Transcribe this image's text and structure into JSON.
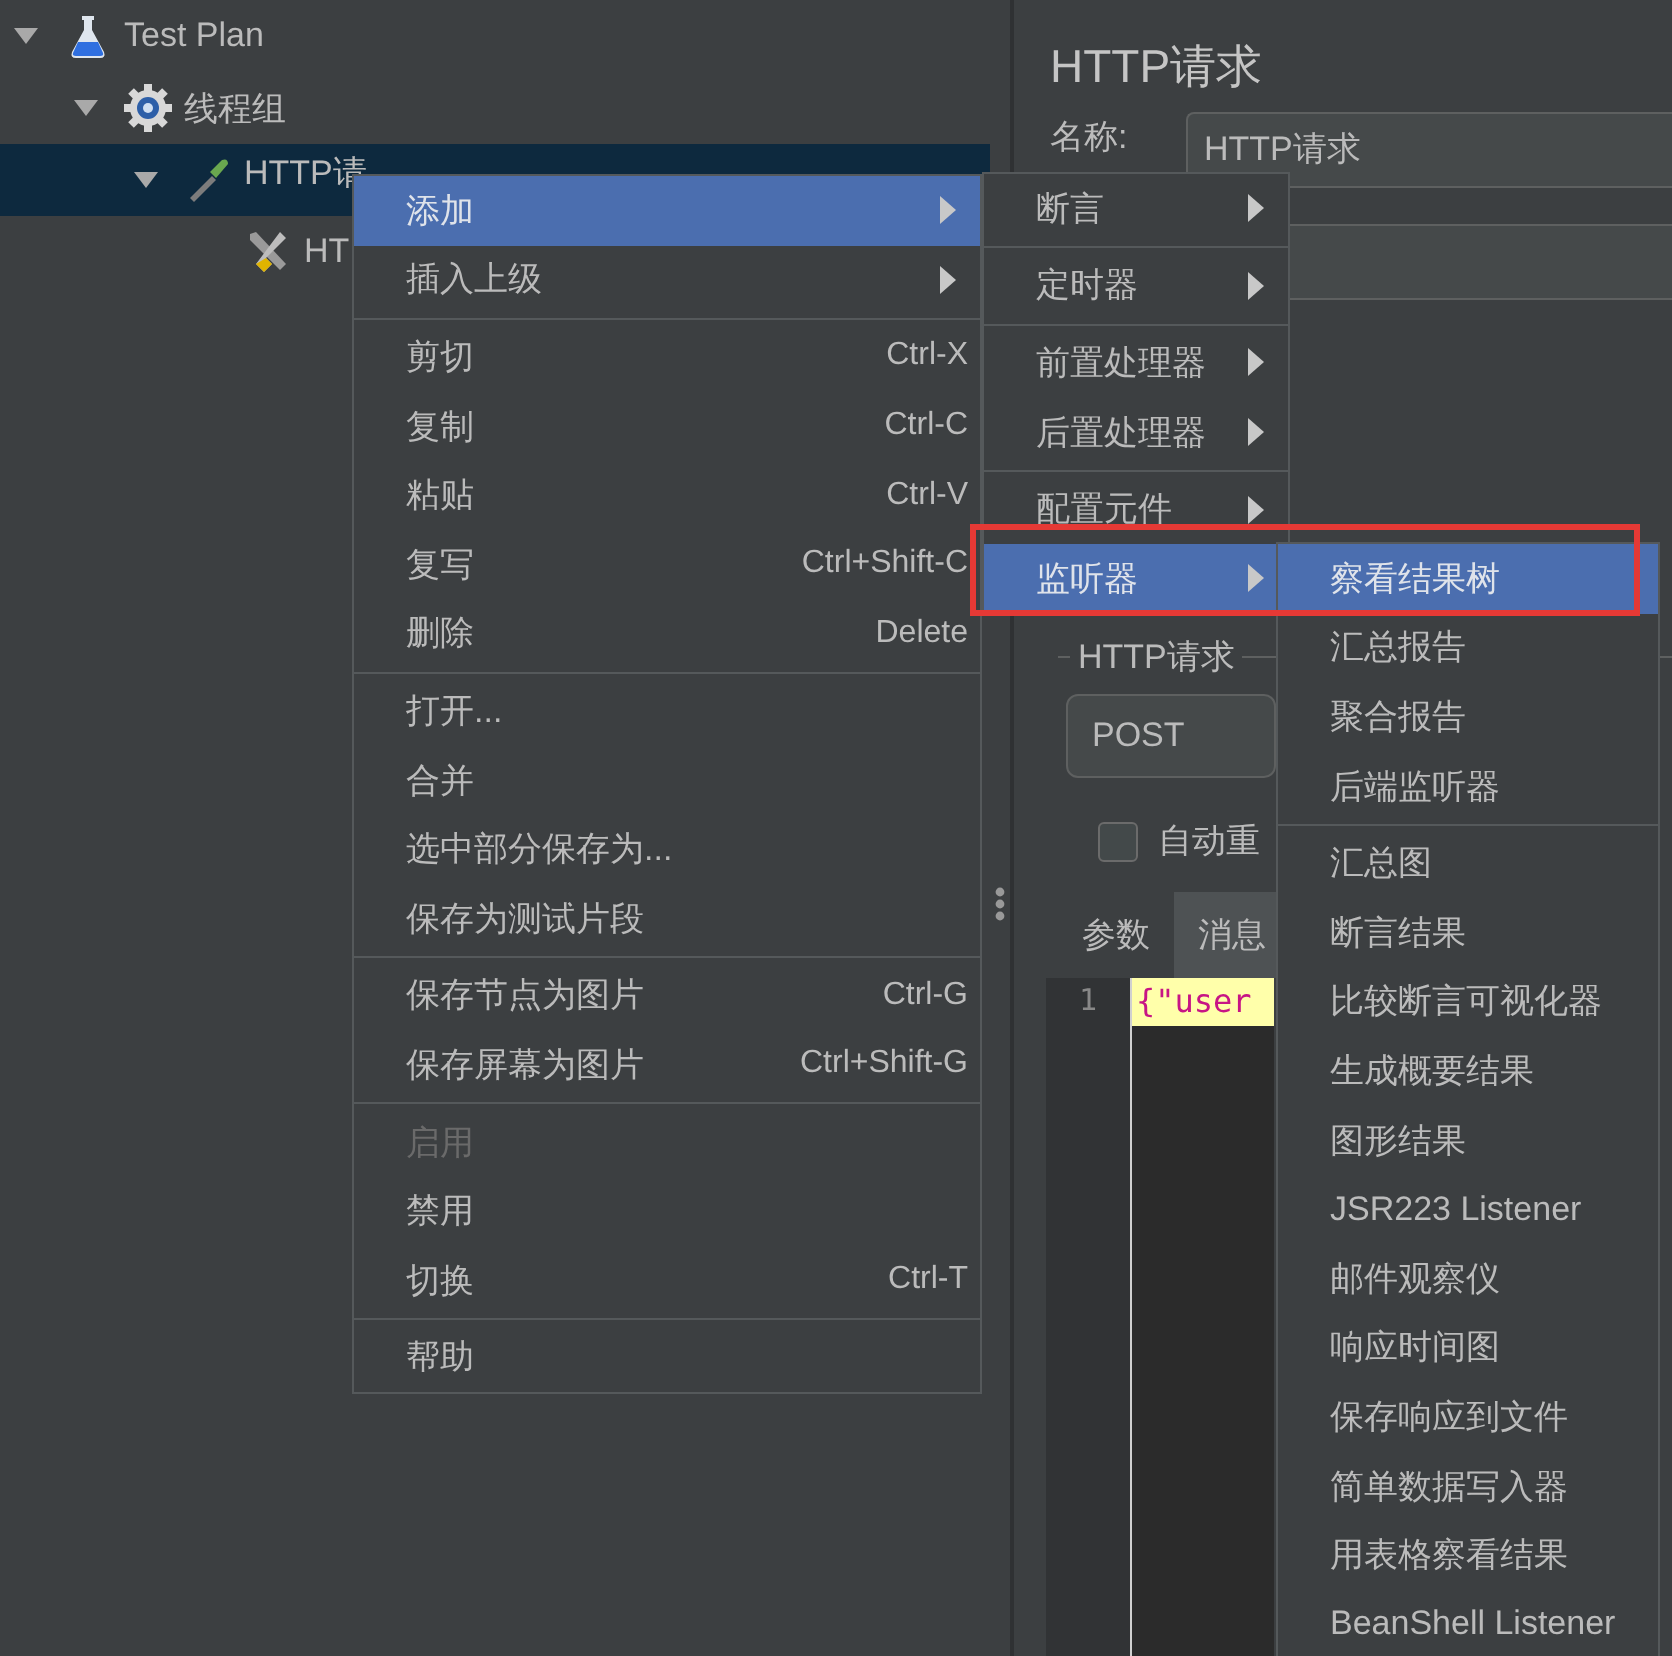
{
  "tree": [
    {
      "label": "Test Plan",
      "kind": "plan",
      "expanded": true,
      "selected": false,
      "children": [
        {
          "label": "线程组",
          "kind": "thread-group",
          "expanded": true,
          "selected": false,
          "children": [
            {
              "label": "HTTP请",
              "kind": "sampler",
              "expanded": true,
              "selected": true,
              "children": [
                {
                  "label": "HT",
                  "kind": "config",
                  "selected": false
                }
              ]
            }
          ]
        }
      ]
    }
  ],
  "editor": {
    "title": "HTTP请求",
    "name_label": "名称:",
    "name_value": "HTTP请求",
    "section_title": "HTTP请求",
    "method": "POST",
    "checkbox": {
      "label": "自动重",
      "checked": false
    },
    "tabs": [
      {
        "label": "参数",
        "selected": false
      },
      {
        "label": "消息",
        "selected": true
      }
    ],
    "code_lines": [
      {
        "number": "1",
        "text": "{\"user"
      }
    ]
  },
  "context_menu": [
    {
      "kind": "item",
      "label": "添加",
      "submenu": true,
      "selected": true,
      "disabled": false
    },
    {
      "kind": "item",
      "label": "插入上级",
      "submenu": true,
      "selected": false,
      "disabled": false
    },
    {
      "kind": "separator"
    },
    {
      "kind": "item",
      "label": "剪切",
      "shortcut": "Ctrl-X",
      "submenu": false,
      "selected": false,
      "disabled": false
    },
    {
      "kind": "item",
      "label": "复制",
      "shortcut": "Ctrl-C",
      "submenu": false,
      "selected": false,
      "disabled": false
    },
    {
      "kind": "item",
      "label": "粘贴",
      "shortcut": "Ctrl-V",
      "submenu": false,
      "selected": false,
      "disabled": false
    },
    {
      "kind": "item",
      "label": "复写",
      "shortcut": "Ctrl+Shift-C",
      "submenu": false,
      "selected": false,
      "disabled": false
    },
    {
      "kind": "item",
      "label": "删除",
      "shortcut": "Delete",
      "submenu": false,
      "selected": false,
      "disabled": false
    },
    {
      "kind": "separator"
    },
    {
      "kind": "item",
      "label": "打开...",
      "submenu": false,
      "selected": false,
      "disabled": false
    },
    {
      "kind": "item",
      "label": "合并",
      "submenu": false,
      "selected": false,
      "disabled": false
    },
    {
      "kind": "item",
      "label": "选中部分保存为...",
      "submenu": false,
      "selected": false,
      "disabled": false
    },
    {
      "kind": "item",
      "label": "保存为测试片段",
      "submenu": false,
      "selected": false,
      "disabled": false
    },
    {
      "kind": "separator"
    },
    {
      "kind": "item",
      "label": "保存节点为图片",
      "shortcut": "Ctrl-G",
      "submenu": false,
      "selected": false,
      "disabled": false
    },
    {
      "kind": "item",
      "label": "保存屏幕为图片",
      "shortcut": "Ctrl+Shift-G",
      "submenu": false,
      "selected": false,
      "disabled": false
    },
    {
      "kind": "separator"
    },
    {
      "kind": "item",
      "label": "启用",
      "submenu": false,
      "selected": false,
      "disabled": true
    },
    {
      "kind": "item",
      "label": "禁用",
      "submenu": false,
      "selected": false,
      "disabled": false
    },
    {
      "kind": "item",
      "label": "切换",
      "shortcut": "Ctrl-T",
      "submenu": false,
      "selected": false,
      "disabled": false
    },
    {
      "kind": "separator"
    },
    {
      "kind": "item",
      "label": "帮助",
      "submenu": false,
      "selected": false,
      "disabled": false
    }
  ],
  "add_submenu": [
    {
      "kind": "item",
      "label": "断言",
      "submenu": true,
      "selected": false
    },
    {
      "kind": "separator"
    },
    {
      "kind": "item",
      "label": "定时器",
      "submenu": true,
      "selected": false
    },
    {
      "kind": "separator"
    },
    {
      "kind": "item",
      "label": "前置处理器",
      "submenu": true,
      "selected": false
    },
    {
      "kind": "item",
      "label": "后置处理器",
      "submenu": true,
      "selected": false
    },
    {
      "kind": "separator"
    },
    {
      "kind": "item",
      "label": "配置元件",
      "submenu": true,
      "selected": false
    },
    {
      "kind": "item",
      "label": "监听器",
      "submenu": true,
      "selected": true
    }
  ],
  "listener_submenu": [
    {
      "kind": "item",
      "label": "察看结果树",
      "submenu": false,
      "selected": true
    },
    {
      "kind": "item",
      "label": "汇总报告",
      "submenu": false,
      "selected": false
    },
    {
      "kind": "item",
      "label": "聚合报告",
      "submenu": false,
      "selected": false
    },
    {
      "kind": "item",
      "label": "后端监听器",
      "submenu": false,
      "selected": false
    },
    {
      "kind": "separator"
    },
    {
      "kind": "item",
      "label": "汇总图",
      "submenu": false,
      "selected": false
    },
    {
      "kind": "item",
      "label": "断言结果",
      "submenu": false,
      "selected": false
    },
    {
      "kind": "item",
      "label": "比较断言可视化器",
      "submenu": false,
      "selected": false
    },
    {
      "kind": "item",
      "label": "生成概要结果",
      "submenu": false,
      "selected": false
    },
    {
      "kind": "item",
      "label": "图形结果",
      "submenu": false,
      "selected": false
    },
    {
      "kind": "item",
      "label": "JSR223 Listener",
      "submenu": false,
      "selected": false
    },
    {
      "kind": "item",
      "label": "邮件观察仪",
      "submenu": false,
      "selected": false
    },
    {
      "kind": "item",
      "label": "响应时间图",
      "submenu": false,
      "selected": false
    },
    {
      "kind": "item",
      "label": "保存响应到文件",
      "submenu": false,
      "selected": false
    },
    {
      "kind": "item",
      "label": "简单数据写入器",
      "submenu": false,
      "selected": false
    },
    {
      "kind": "item",
      "label": "用表格察看结果",
      "submenu": false,
      "selected": false
    },
    {
      "kind": "item",
      "label": "BeanShell Listener",
      "submenu": false,
      "selected": false
    }
  ]
}
